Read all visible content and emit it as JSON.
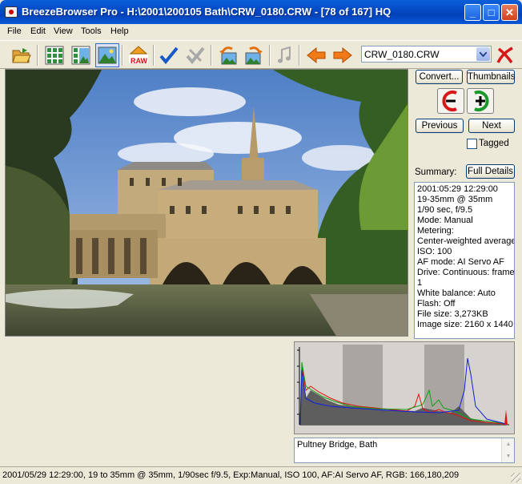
{
  "window": {
    "title": "BreezeBrowser Pro - H:\\2001\\200105 Bath\\CRW_0180.CRW - [78 of 167] HQ"
  },
  "menu": [
    "File",
    "Edit",
    "View",
    "Tools",
    "Help"
  ],
  "toolbar": {
    "raw_label": "RAW",
    "file_combo_value": "CRW_0180.CRW"
  },
  "panel": {
    "convert_label": "Convert...",
    "thumbnails_label": "Thumbnails",
    "previous_label": "Previous",
    "next_label": "Next",
    "tagged_label": "Tagged",
    "summary_label": "Summary:",
    "full_details_label": "Full Details"
  },
  "info_lines": [
    "2001:05:29 12:29:00",
    "19-35mm @ 35mm",
    "1/90 sec, f/9.5",
    "Mode: Manual",
    "Metering:",
    "Center-weighted average",
    "ISO: 100",
    "AF mode: AI Servo AF",
    "Drive: Continuous: frame",
    "1",
    "White balance: Auto",
    "Flash: Off",
    "File size: 3,273KB",
    "Image size: 2160 x 1440"
  ],
  "caption": "Pultney Bridge, Bath",
  "status": "2001/05/29 12:29:00, 19 to 35mm @ 35mm, 1/90sec f/9.5, Exp:Manual, ISO 100, AF:AI Servo AF,    RGB: 166,180,209"
}
